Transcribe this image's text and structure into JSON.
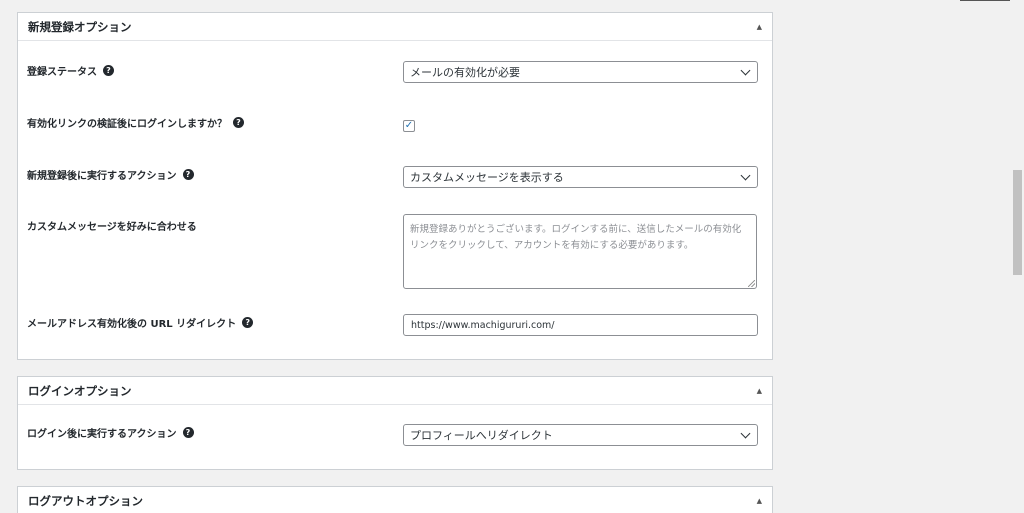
{
  "registration": {
    "title": "新規登録オプション",
    "toggle_icon": "▲",
    "status_label": "登録ステータス",
    "status_value": "メールの有効化が必要",
    "login_after_label": "有効化リンクの検証後にログインしますか？",
    "login_after_checked": "✓",
    "action_label": "新規登録後に実行するアクション",
    "action_value": "カスタムメッセージを表示する",
    "message_label": "カスタムメッセージを好みに合わせる",
    "message_placeholder": "新規登録ありがとうございます。ログインする前に、送信したメールの有効化リンクをクリックして、アカウントを有効にする必要があります。",
    "redirect_label": "メールアドレス有効化後の URL リダイレクト",
    "redirect_value": "https://www.machigururi.com/"
  },
  "login": {
    "title": "ログインオプション",
    "toggle_icon": "▲",
    "action_label": "ログイン後に実行するアクション",
    "action_value": "プロフィールへリダイレクト"
  },
  "logout": {
    "title": "ログアウトオプション",
    "toggle_icon": "▲"
  },
  "help_icon": "?"
}
